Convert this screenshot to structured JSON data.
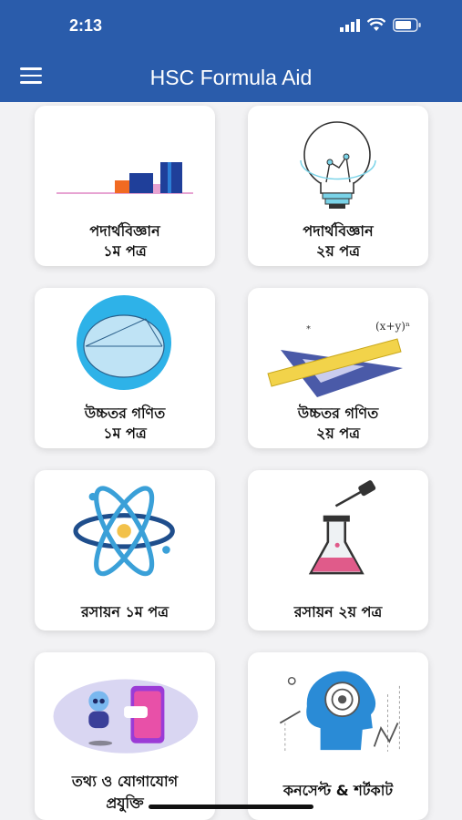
{
  "status": {
    "time": "2:13"
  },
  "appbar": {
    "title": "HSC Formula Aid"
  },
  "cards": [
    {
      "line1": "পদার্থবিজ্ঞান",
      "line2": "১ম পত্র"
    },
    {
      "line1": "পদার্থবিজ্ঞান",
      "line2": "২য় পত্র"
    },
    {
      "line1": "উচ্চতর গণিত",
      "line2": "১ম পত্র"
    },
    {
      "line1": "উচ্চতর গণিত",
      "line2": "২য় পত্র"
    },
    {
      "line1": "রসায়ন ১ম পত্র",
      "line2": ""
    },
    {
      "line1": "রসায়ন ২য় পত্র",
      "line2": ""
    },
    {
      "line1": "তথ্য ও যোগাযোগ",
      "line2": "প্রযুক্তি"
    },
    {
      "line1": "কনসেপ্ট & শর্টকাট",
      "line2": ""
    }
  ],
  "colors": {
    "appbar": "#2a5cab",
    "background": "#f2f2f4"
  }
}
